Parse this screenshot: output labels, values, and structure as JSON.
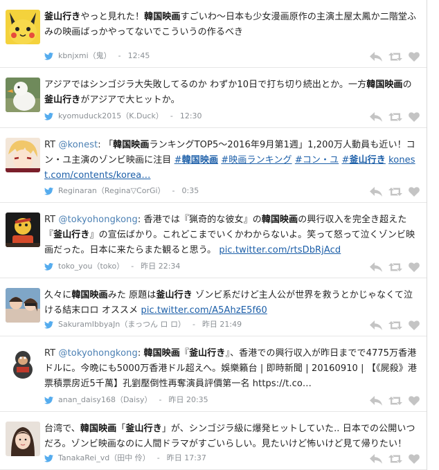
{
  "tweets": [
    {
      "segments": [
        {
          "t": "釜山行き",
          "b": true
        },
        {
          "t": "やっと見れた！"
        },
        {
          "t": "韓国映画",
          "b": true
        },
        {
          "t": "すごいわ〜日本も少女漫画原作の主演土屋太鳳か二階堂ふみの映画ばっかやってないでこういうの作るべき"
        }
      ],
      "user": "kbnjxmi",
      "name": "（鬼）",
      "time": "12:45",
      "avatar": "pikachu"
    },
    {
      "segments": [
        {
          "t": "アジアではシンゴジラ大失敗してるのか わずか10日で打ち切り続出とか。一方"
        },
        {
          "t": "韓国映画",
          "b": true
        },
        {
          "t": "の"
        },
        {
          "t": "釜山行き",
          "b": true
        },
        {
          "t": "がアジアで大ヒットか。"
        }
      ],
      "user": "kyomuduck2015",
      "name": "（K.Duck）",
      "time": "12:30",
      "avatar": "duck"
    },
    {
      "segments": [
        {
          "t": "RT ",
          "c": "rt"
        },
        {
          "t": "@konest",
          "c": "mention"
        },
        {
          "t": ": 「"
        },
        {
          "t": "韓国映画",
          "b": true
        },
        {
          "t": "ランキングTOP5～2016年9月第1週」1,200万人動員も近い！コン・ユ主演のゾンビ映画に注目 "
        },
        {
          "t": "#",
          "c": "link"
        },
        {
          "t": "韓国映画",
          "c": "link",
          "b": true
        },
        {
          "t": " "
        },
        {
          "t": "#映画ランキング",
          "c": "link"
        },
        {
          "t": " "
        },
        {
          "t": "#コン・ユ",
          "c": "link"
        },
        {
          "t": " "
        },
        {
          "t": "#",
          "c": "link"
        },
        {
          "t": "釜山行き",
          "c": "link",
          "b": true
        },
        {
          "t": " "
        },
        {
          "t": "konest.com/contents/korea…",
          "c": "link"
        }
      ],
      "user": "Reginaran",
      "name": "（Regina▽CorGi）",
      "time": "0:35",
      "avatar": "anime"
    },
    {
      "segments": [
        {
          "t": "RT ",
          "c": "rt"
        },
        {
          "t": "@tokyohongkong",
          "c": "mention"
        },
        {
          "t": ": 香港では『猟奇的な彼女』の"
        },
        {
          "t": "韓国映画",
          "b": true
        },
        {
          "t": "の興行収入を完全き超えた『"
        },
        {
          "t": "釜山行き",
          "b": true
        },
        {
          "t": "』の宣伝ばかり。これどこまでいくかわからないよ。笑って怒って泣くゾンビ映画だった。日本に来たらまた観ると思う。 "
        },
        {
          "t": "pic.twitter.com/rtsDbRjAcd",
          "c": "link"
        }
      ],
      "user": "toko_you",
      "name": "（toko）",
      "time": "昨日 22:34",
      "avatar": "figure"
    },
    {
      "segments": [
        {
          "t": "久々に"
        },
        {
          "t": "韓国映画",
          "b": true
        },
        {
          "t": "みた 原題は"
        },
        {
          "t": "釜山行き",
          "b": true
        },
        {
          "t": " ゾンビ系だけど主人公が世界を救うとかじゃなくて泣ける結末ロロ オススメ "
        },
        {
          "t": "pic.twitter.com/A5AhzE5f60",
          "c": "link"
        }
      ],
      "user": "SakuramIbbyaJn",
      "name": "（まっつん ロ ロ）",
      "time": "昨日 21:49",
      "avatar": "friends"
    },
    {
      "segments": [
        {
          "t": "RT ",
          "c": "rt"
        },
        {
          "t": "@tokyohongkong",
          "c": "mention"
        },
        {
          "t": ": "
        },
        {
          "t": "韓国映画",
          "b": true
        },
        {
          "t": "『"
        },
        {
          "t": "釜山行き",
          "b": true
        },
        {
          "t": "』、香港での興行収入が昨日までで4775万香港ドルに。今晩にも5000万香港ドル超えへ。娛樂籟台 | 即時新聞 | 20160910 | 【《屍殺》港票積票房近5千萬】孔劉壓倒性再奪演員評價第一名 https://t.co…"
        }
      ],
      "user": "anan_daisy168",
      "name": "（Daisy）",
      "time": "昨日 20:35",
      "avatar": "gorilla"
    },
    {
      "segments": [
        {
          "t": "台湾で、"
        },
        {
          "t": "韓国映画",
          "b": true
        },
        {
          "t": "「"
        },
        {
          "t": "釜山行き",
          "b": true
        },
        {
          "t": "」が、シンゴジラ級に爆発ヒットしていた.. 日本での公開いつだろ。ゾンビ映画なのに人間ドラマがすごいらしい。見たいけど怖いけど見て帰りたい！"
        }
      ],
      "user": "TanakaRei_vd",
      "name": "（田中 伶）",
      "time": "昨日 17:37",
      "avatar": "woman"
    }
  ],
  "colors": {
    "link": "#1b5ea8",
    "mention": "#4a7fb3",
    "bird": "#55acee",
    "meta": "#8a8f94",
    "action": "#c4c4c4"
  }
}
